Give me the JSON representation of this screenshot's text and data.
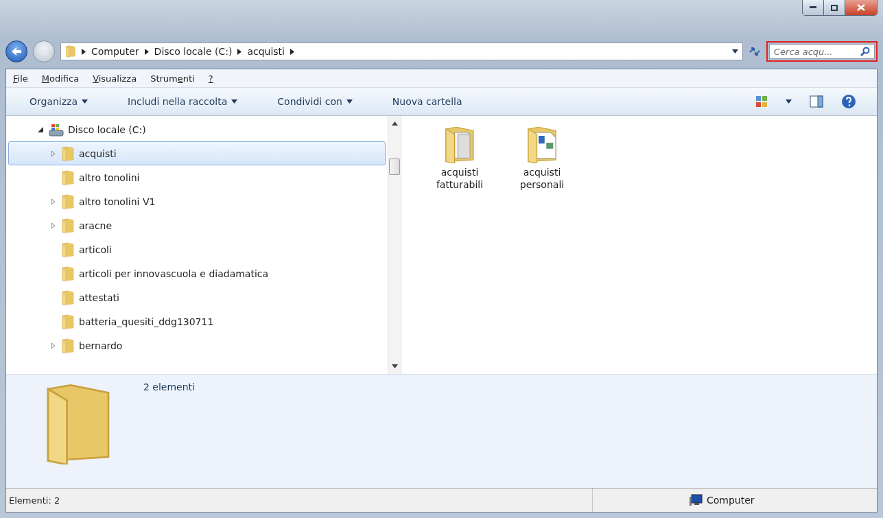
{
  "address_bar": {
    "path": [
      "Computer",
      "Disco locale (C:)",
      "acquisti"
    ]
  },
  "search": {
    "placeholder": "Cerca acqu...",
    "highlighted": true
  },
  "menu": [
    {
      "key": "F",
      "post": "ile"
    },
    {
      "key": "M",
      "post": "odifica"
    },
    {
      "key": "V",
      "post": "isualizza"
    },
    {
      "pre": "Strum",
      "key": "e",
      "post": "nti"
    },
    {
      "key": "?"
    }
  ],
  "toolbar": [
    {
      "label": "Organizza",
      "dropdown": true
    },
    {
      "label": "Includi nella raccolta",
      "dropdown": true
    },
    {
      "label": "Condividi con",
      "dropdown": true
    },
    {
      "label": "Nuova cartella",
      "dropdown": false
    }
  ],
  "tree": {
    "label": "Disco locale (C:)",
    "expanded": true,
    "children": [
      {
        "label": "acquisti",
        "expandable": true,
        "selected": true
      },
      {
        "label": "altro tonolini",
        "expandable": false,
        "selected": false
      },
      {
        "label": "altro tonolini V1",
        "expandable": true,
        "selected": false
      },
      {
        "label": "aracne",
        "expandable": true,
        "selected": false
      },
      {
        "label": "articoli",
        "expandable": false,
        "selected": false
      },
      {
        "label": "articoli per innovascuola e diadamatica",
        "expandable": false,
        "selected": false
      },
      {
        "label": "attestati",
        "expandable": false,
        "selected": false
      },
      {
        "label": "batteria_quesiti_ddg130711",
        "expandable": false,
        "selected": false
      },
      {
        "label": "bernardo",
        "expandable": true,
        "selected": false
      }
    ]
  },
  "files": [
    {
      "name": "acquisti fatturabili",
      "kind": "docs"
    },
    {
      "name": "acquisti personali",
      "kind": "media"
    }
  ],
  "details": {
    "summary": "2 elementi"
  },
  "status_bar": {
    "left": "Elementi: 2",
    "right": "Computer"
  }
}
